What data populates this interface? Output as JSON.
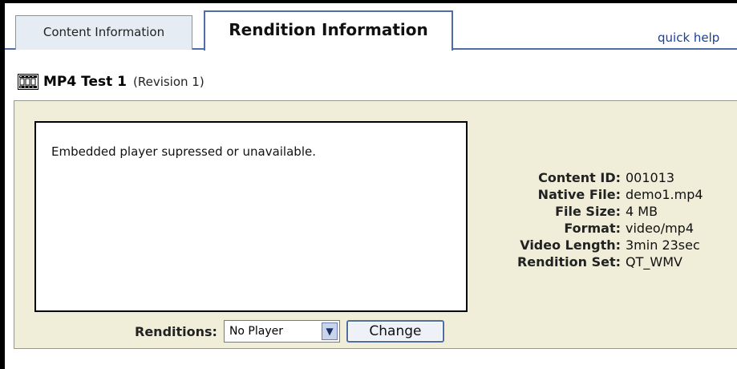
{
  "tabs": [
    {
      "label": "Content Information",
      "active": false
    },
    {
      "label": "Rendition Information",
      "active": true
    }
  ],
  "quick_help": "quick help",
  "item": {
    "title": "MP4 Test 1",
    "revision": "(Revision 1)",
    "icon": "film-icon"
  },
  "player": {
    "message": "Embedded player supressed or unavailable."
  },
  "info": [
    {
      "label": "Content ID:",
      "value": "001013"
    },
    {
      "label": "Native File:",
      "value": "demo1.mp4"
    },
    {
      "label": "File Size:",
      "value": "4 MB"
    },
    {
      "label": "Format:",
      "value": "video/mp4"
    },
    {
      "label": "Video Length:",
      "value": "3min 23sec"
    },
    {
      "label": "Rendition Set:",
      "value": "QT_WMV"
    }
  ],
  "renditions": {
    "label": "Renditions:",
    "selected": "No Player",
    "button": "Change"
  },
  "colors": {
    "accent": "#4f6ea6",
    "panel_bg": "#f0eed9",
    "link": "#1a3f9c"
  }
}
